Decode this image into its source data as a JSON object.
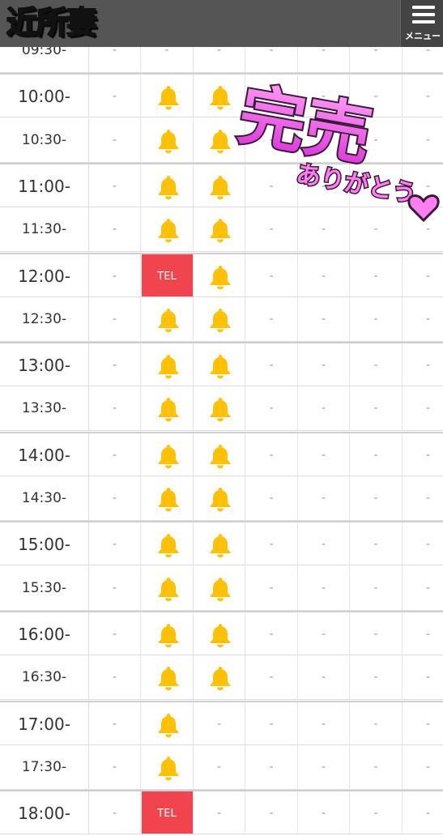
{
  "header": {
    "logo_text": "近所妻",
    "menu_label": "メニュー",
    "background": "#555555"
  },
  "colors": {
    "tel": "#f0444f",
    "bell": "#ffc107",
    "sold_pink": "#e040e0"
  },
  "schedule": {
    "rows": [
      {
        "time": "09:30-",
        "cells": [
          "-",
          "-",
          "-",
          "-",
          "-",
          "-",
          "-"
        ]
      },
      {
        "time": "10:00-",
        "cells": [
          "-",
          "bell",
          "bell",
          "-",
          "-",
          "-",
          "-"
        ]
      },
      {
        "time": "10:30-",
        "cells": [
          "-",
          "bell",
          "bell",
          "-",
          "-",
          "-",
          "-"
        ]
      },
      {
        "time": "11:00-",
        "cells": [
          "-",
          "bell",
          "bell",
          "-",
          "-",
          "-",
          "-"
        ]
      },
      {
        "time": "11:30-",
        "cells": [
          "-",
          "bell",
          "bell",
          "-",
          "-",
          "-",
          "-"
        ]
      },
      {
        "time": "12:00-",
        "cells": [
          "-",
          "TEL",
          "bell",
          "-",
          "-",
          "-",
          "-"
        ]
      },
      {
        "time": "12:30-",
        "cells": [
          "-",
          "bell",
          "bell",
          "-",
          "-",
          "-",
          "-"
        ]
      },
      {
        "time": "13:00-",
        "cells": [
          "-",
          "bell",
          "bell",
          "-",
          "-",
          "-",
          "-"
        ]
      },
      {
        "time": "13:30-",
        "cells": [
          "-",
          "bell",
          "bell",
          "-",
          "-",
          "-",
          "-"
        ]
      },
      {
        "time": "14:00-",
        "cells": [
          "-",
          "bell",
          "bell",
          "-",
          "-",
          "-",
          "-"
        ]
      },
      {
        "time": "14:30-",
        "cells": [
          "-",
          "bell",
          "bell",
          "-",
          "-",
          "-",
          "-"
        ]
      },
      {
        "time": "15:00-",
        "cells": [
          "-",
          "bell",
          "bell",
          "-",
          "-",
          "-",
          "-"
        ]
      },
      {
        "time": "15:30-",
        "cells": [
          "-",
          "bell",
          "bell",
          "-",
          "-",
          "-",
          "-"
        ]
      },
      {
        "time": "16:00-",
        "cells": [
          "-",
          "bell",
          "bell",
          "-",
          "-",
          "-",
          "-"
        ]
      },
      {
        "time": "16:30-",
        "cells": [
          "-",
          "bell",
          "bell",
          "-",
          "-",
          "-",
          "-"
        ]
      },
      {
        "time": "17:00-",
        "cells": [
          "-",
          "bell",
          "-",
          "-",
          "-",
          "-",
          "-"
        ]
      },
      {
        "time": "17:30-",
        "cells": [
          "-",
          "bell",
          "-",
          "-",
          "-",
          "-",
          "-"
        ]
      },
      {
        "time": "18:00-",
        "cells": [
          "-",
          "TEL",
          "-",
          "-",
          "-",
          "-",
          "-"
        ]
      }
    ]
  },
  "sold_out": {
    "main": "完売",
    "sub": "ありがとう"
  }
}
